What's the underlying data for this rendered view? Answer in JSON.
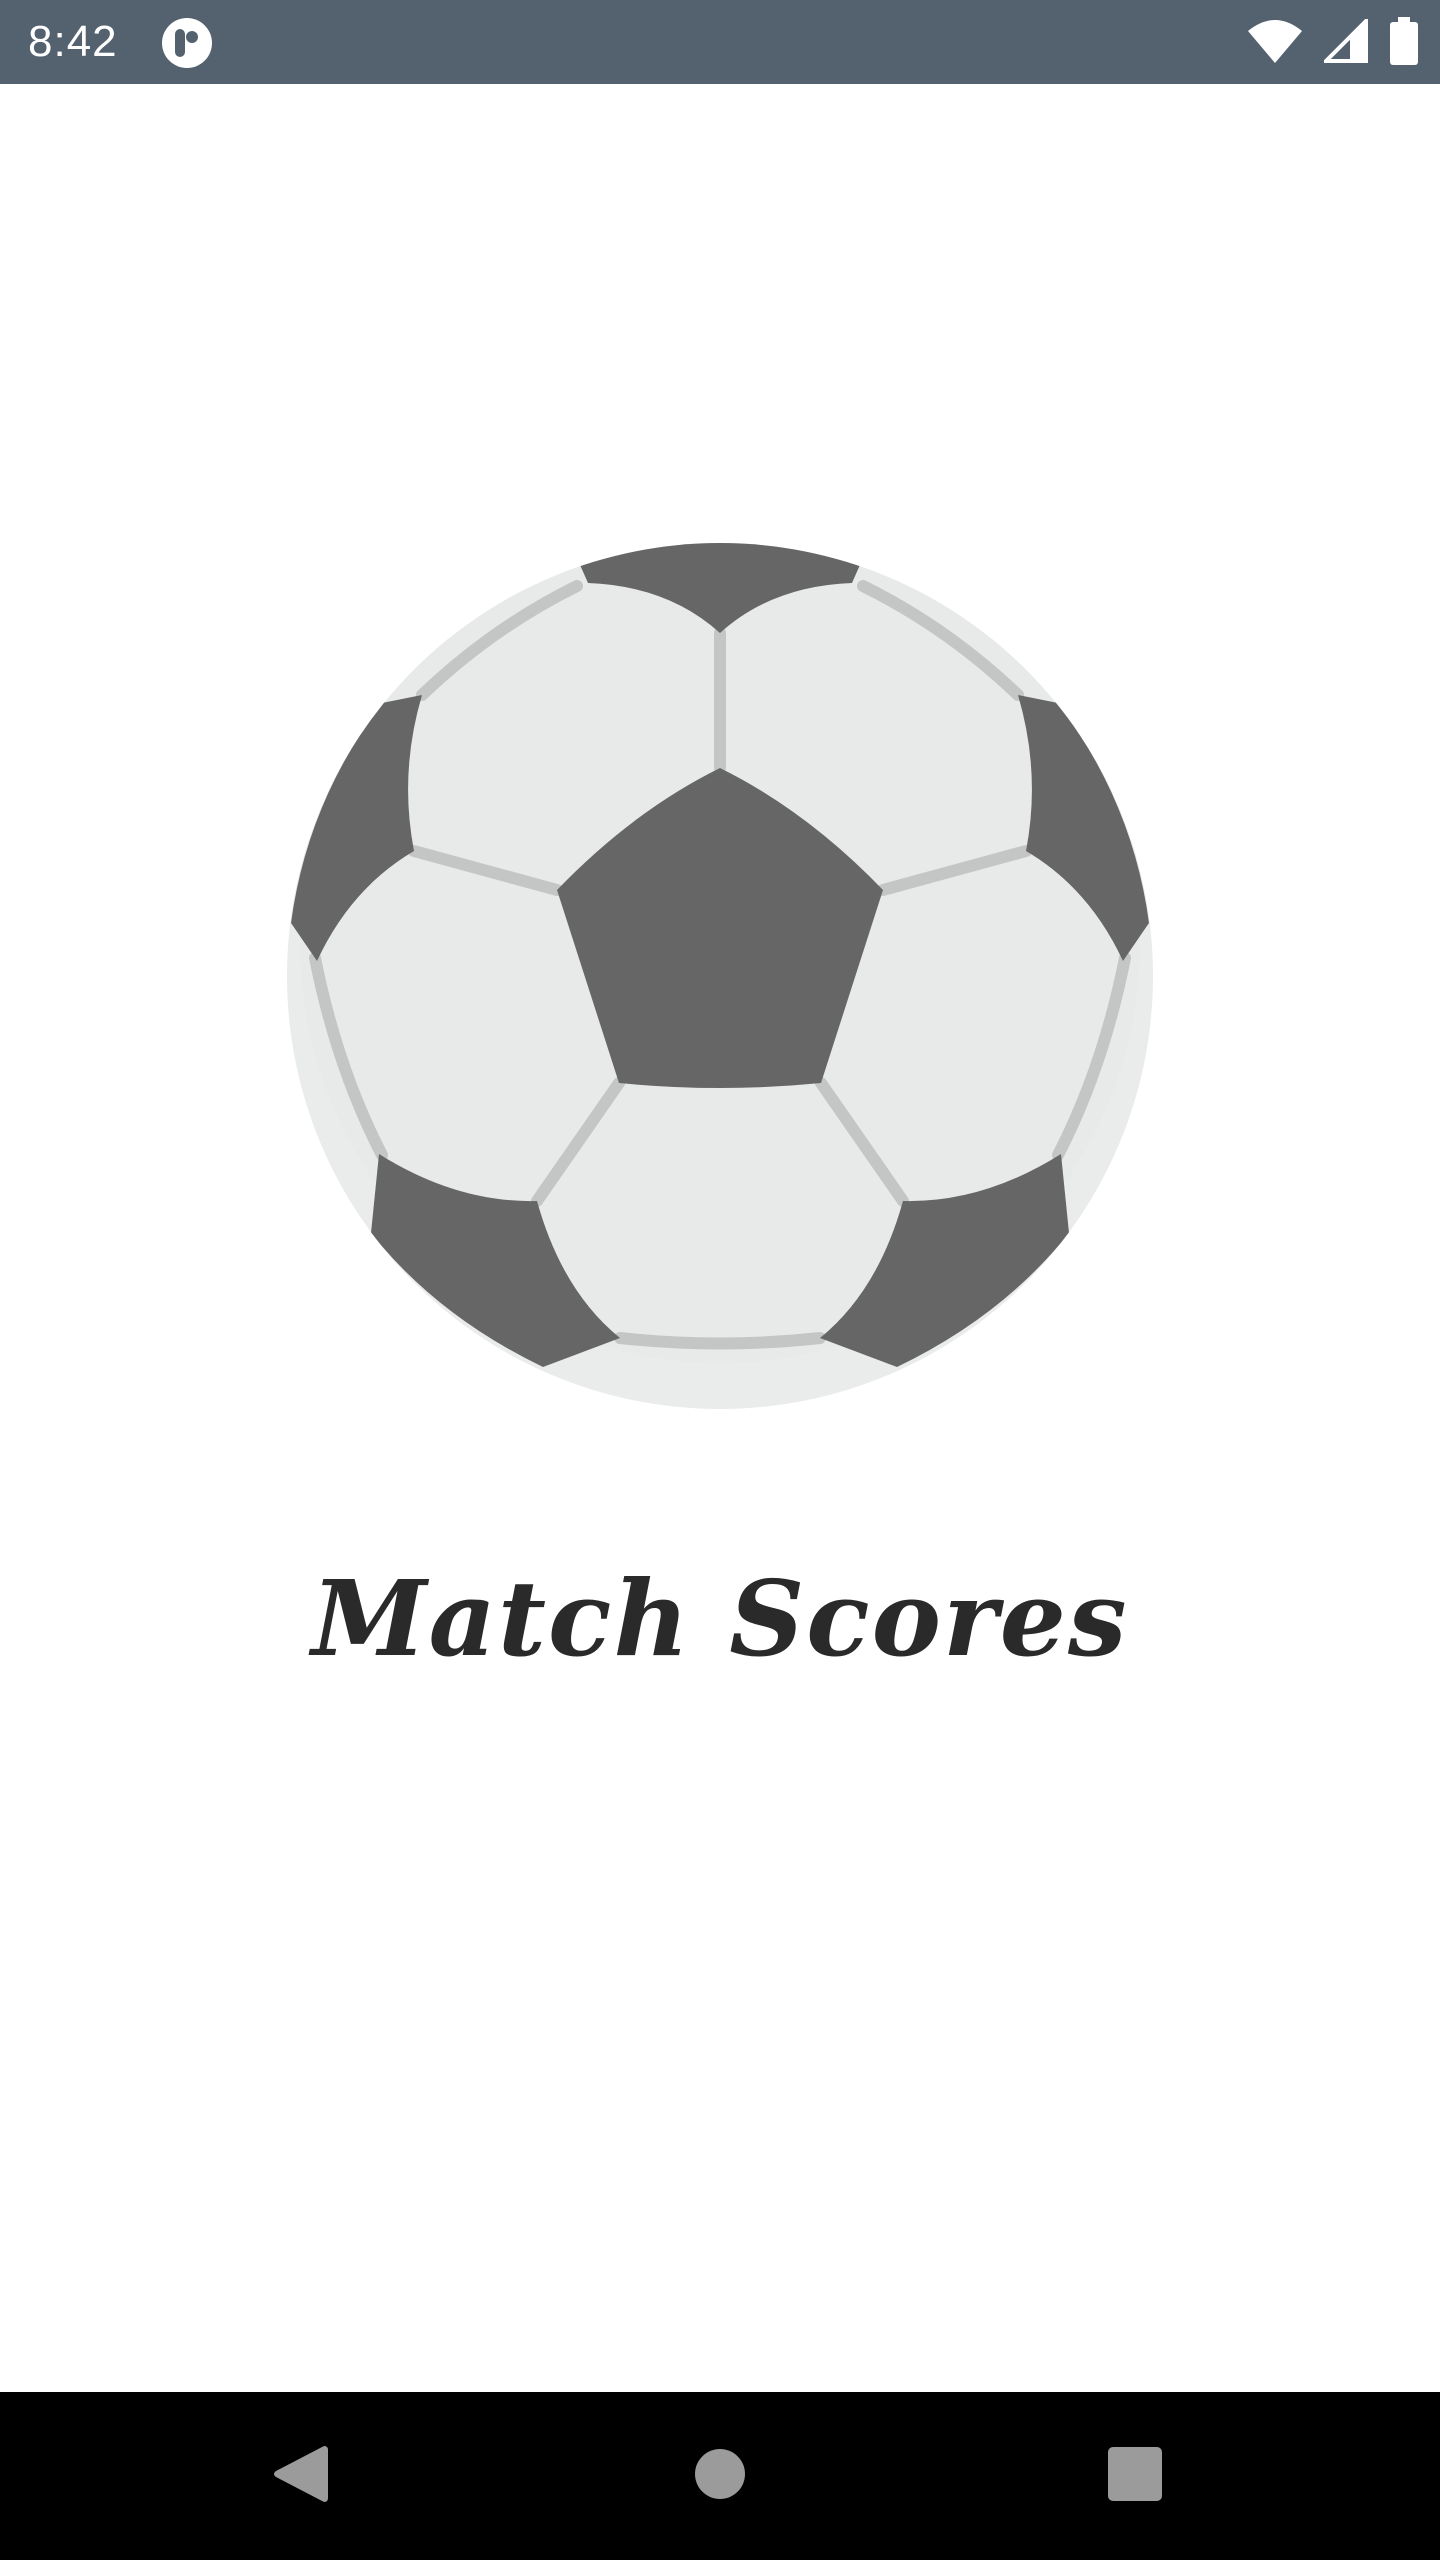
{
  "status_bar": {
    "time": "8:42",
    "background_color": "#546270",
    "icons": [
      "app-notification-icon",
      "wifi-icon",
      "cell-signal-icon",
      "battery-icon"
    ]
  },
  "splash": {
    "logo_icon": "soccer-ball-icon",
    "title": "Match Scores",
    "colors": {
      "ball_background": "#eaebeb",
      "ball_panel": "#666666",
      "ball_seam": "#c4c6c5"
    }
  },
  "nav_bar": {
    "background_color": "#000000",
    "buttons": [
      "back-icon",
      "home-icon",
      "recents-icon"
    ],
    "button_color": "#9b9b9b"
  }
}
